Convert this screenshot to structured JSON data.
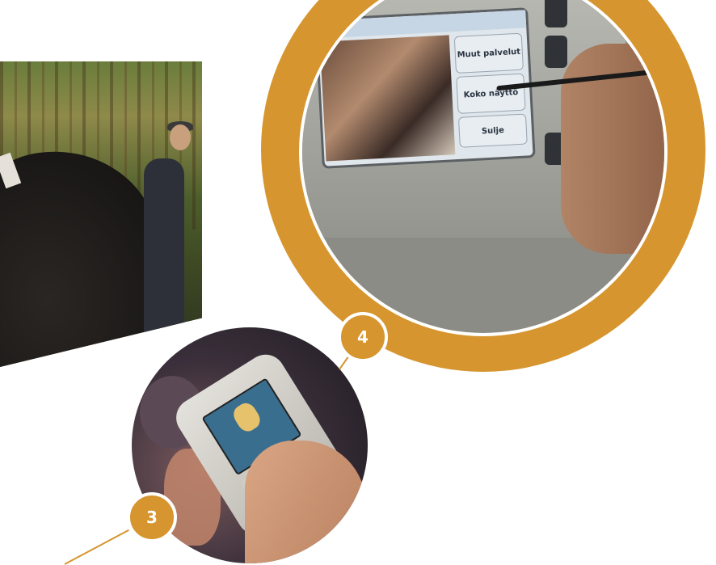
{
  "callouts": {
    "badge_4": "4",
    "badge_3": "3"
  },
  "device_screen": {
    "menu_1": "Muut palvelut",
    "menu_2": "Koko näyttö",
    "menu_3": "Sulje"
  },
  "colors": {
    "accent": "#d6952e",
    "background": "#ffffff"
  }
}
